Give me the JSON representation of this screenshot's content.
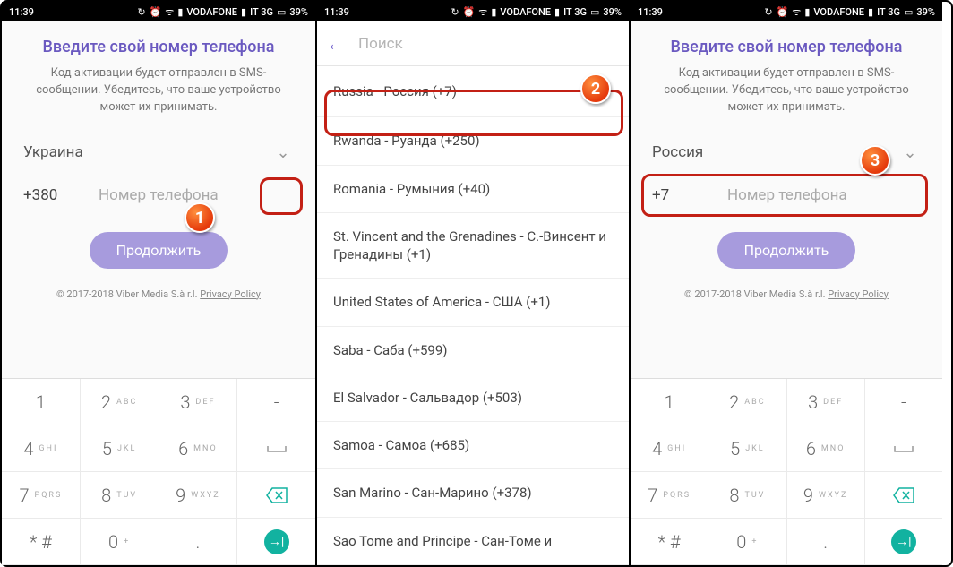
{
  "status": {
    "time": "11:39",
    "carrier": "VODAFONE",
    "net_icon": "IT 3G",
    "battery": "39%"
  },
  "viber": {
    "title": "Введите свой номер телефона",
    "subtitle": "Код активации будет отправлен в SMS-сообщении. Убедитесь, что ваше устройство может их принимать.",
    "country_ukraine": "Украина",
    "code_ukraine": "+380",
    "country_russia": "Россия",
    "code_russia": "+7",
    "phone_placeholder": "Номер телефона",
    "continue": "Продолжить",
    "footer_text": "© 2017-2018 Viber Media S.à r.l. ",
    "privacy": "Privacy Policy"
  },
  "search": {
    "placeholder": "Поиск",
    "items": [
      "Russia - Россия (+7)",
      "Rwanda - Руанда (+250)",
      "Romania - Румыния (+40)",
      "St. Vincent and the Grenadines - С.-Винсент и Гренадины (+1)",
      "United States of America - США (+1)",
      "Saba - Саба (+599)",
      "El Salvador - Сальвадор (+503)",
      "Samoa - Самоа (+685)",
      "San Marino - Сан-Марино (+378)",
      "Sao Tome and Principe - Сан-Томе и"
    ]
  },
  "keypad": {
    "rows": [
      [
        {
          "d": "1",
          "l": ""
        },
        {
          "d": "2",
          "l": "ABC"
        },
        {
          "d": "3",
          "l": "DEF"
        },
        {
          "d": "-",
          "l": ""
        }
      ],
      [
        {
          "d": "4",
          "l": "GHI"
        },
        {
          "d": "5",
          "l": "JKL"
        },
        {
          "d": "6",
          "l": "MNO"
        },
        {
          "d": "",
          "l": "",
          "action": "space"
        }
      ],
      [
        {
          "d": "7",
          "l": "PQRS"
        },
        {
          "d": "8",
          "l": "TUV"
        },
        {
          "d": "9",
          "l": "WXYZ"
        },
        {
          "d": "",
          "l": "",
          "action": "backspace"
        }
      ],
      [
        {
          "d": "* #",
          "l": ""
        },
        {
          "d": "0",
          "l": "+"
        },
        {
          "d": ".",
          "l": ""
        },
        {
          "d": "",
          "l": "",
          "action": "go"
        }
      ]
    ]
  },
  "steps": {
    "s1": "1",
    "s2": "2",
    "s3": "3"
  }
}
